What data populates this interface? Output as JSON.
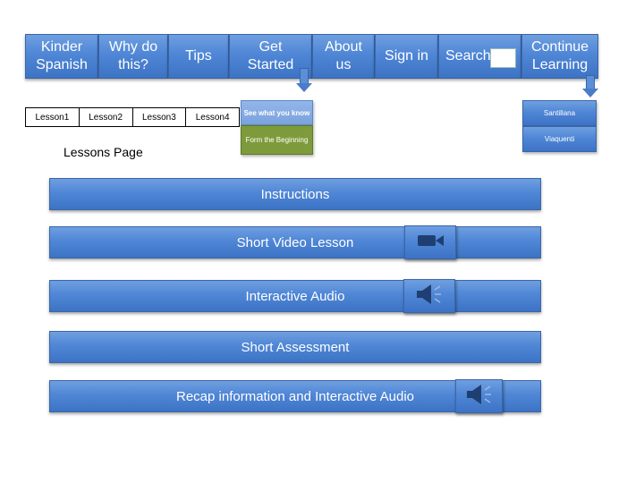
{
  "nav": {
    "items": [
      {
        "label": "Kinder\nSpanish"
      },
      {
        "label": "Why do\nthis?"
      },
      {
        "label": "Tips"
      },
      {
        "label": "Get\nStarted"
      },
      {
        "label": "About\nus"
      },
      {
        "label": "Sign in"
      },
      {
        "label": "Search"
      },
      {
        "label": "Continue\nLearning"
      }
    ]
  },
  "lessons": [
    "Lesson1",
    "Lesson2",
    "Lesson3",
    "Lesson4"
  ],
  "get_started_menu": [
    "See what you know",
    "Form the Beginning"
  ],
  "continue_learning_menu": [
    "Santillana",
    "Viaquenti"
  ],
  "page_title": "Lessons Page",
  "sections": [
    {
      "label": "Instructions"
    },
    {
      "label": "Short Video Lesson",
      "icon": "video-camera-icon"
    },
    {
      "label": "Interactive Audio",
      "icon": "speaker-icon"
    },
    {
      "label": "Short Assessment"
    },
    {
      "label": "Recap information and Interactive Audio",
      "icon": "speaker-icon"
    }
  ],
  "colors": {
    "accent": "#4f86d6",
    "green": "#7e9b3c"
  }
}
